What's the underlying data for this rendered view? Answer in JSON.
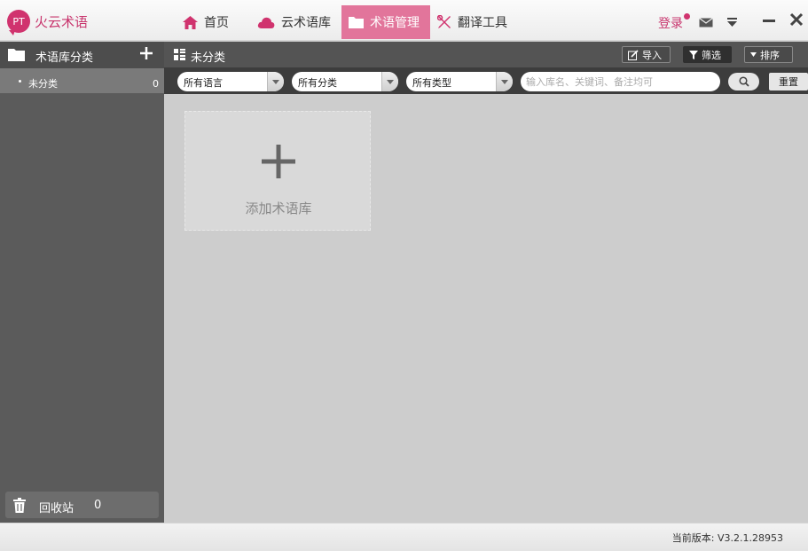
{
  "app": {
    "logo_text": "PT",
    "title": "火云术语"
  },
  "nav": {
    "tabs": [
      {
        "label": "首页",
        "icon": "home-icon"
      },
      {
        "label": "云术语库",
        "icon": "cloud-icon"
      },
      {
        "label": "术语管理",
        "icon": "folder-icon",
        "active": true
      },
      {
        "label": "翻译工具",
        "icon": "tools-icon"
      }
    ]
  },
  "window": {
    "login_label": "登录"
  },
  "sidebar": {
    "header": "术语库分类",
    "items": [
      {
        "label": "未分类",
        "count": "0"
      }
    ],
    "recycle": {
      "label": "回收站",
      "count": "0"
    }
  },
  "toolbar": {
    "title": "未分类",
    "import_label": "导入",
    "filter_label": "筛选",
    "sort_label": "排序"
  },
  "filters": {
    "language": "所有语言",
    "category": "所有分类",
    "type": "所有类型",
    "search_placeholder": "输入库名、关键词、备注均可",
    "reset_label": "重置"
  },
  "main": {
    "add_label": "添加术语库"
  },
  "status": {
    "version": "当前版本: V3.2.1.28953"
  },
  "colors": {
    "brand": "#c8356d",
    "active_tab": "#e2759b",
    "sidebar": "#5b5b5b"
  }
}
